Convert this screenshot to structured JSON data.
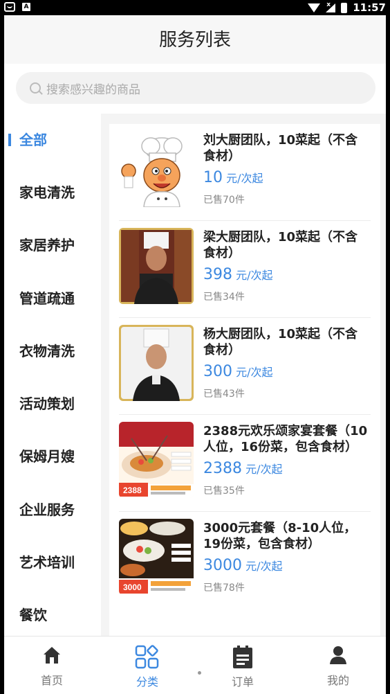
{
  "status_bar": {
    "time": "11:57"
  },
  "header": {
    "title": "服务列表"
  },
  "search": {
    "placeholder": "搜索感兴趣的商品"
  },
  "categories": [
    {
      "label": "全部",
      "active": true
    },
    {
      "label": "家电清洗"
    },
    {
      "label": "家居养护"
    },
    {
      "label": "管道疏通"
    },
    {
      "label": "衣物清洗"
    },
    {
      "label": "活动策划"
    },
    {
      "label": "保姆月嫂"
    },
    {
      "label": "企业服务"
    },
    {
      "label": "艺术培训"
    },
    {
      "label": "餐饮"
    }
  ],
  "products": [
    {
      "title": "刘大厨团队，10菜起（不含食材）",
      "price": "10",
      "unit": "元/次起",
      "sold": "已售70件",
      "image": "cartoon-chef"
    },
    {
      "title": "梁大厨团队，10菜起（不含食材）",
      "price": "398",
      "unit": "元/次起",
      "sold": "已售34件",
      "image": "chef-photo"
    },
    {
      "title": "杨大厨团队，10菜起（不含食材）",
      "price": "300",
      "unit": "元/次起",
      "sold": "已售43件",
      "image": "chef-photo"
    },
    {
      "title": "2388元欢乐颂家宴套餐（10人位，16份菜，包含食材）",
      "price": "2388",
      "unit": "元/次起",
      "sold": "已售35件",
      "image": "banquet-photo",
      "badge": "2388"
    },
    {
      "title": "3000元套餐（8-10人位，19份菜，包含食材）",
      "price": "3000",
      "unit": "元/次起",
      "sold": "已售78件",
      "image": "dishes-photo",
      "badge": "3000"
    }
  ],
  "bottom_nav": [
    {
      "label": "首页",
      "icon": "home-icon"
    },
    {
      "label": "分类",
      "icon": "category-icon",
      "active": true
    },
    {
      "label": "订单",
      "icon": "order-icon"
    },
    {
      "label": "我的",
      "icon": "profile-icon"
    }
  ],
  "colors": {
    "accent": "#3c88e0",
    "badge": "#e8452e"
  }
}
